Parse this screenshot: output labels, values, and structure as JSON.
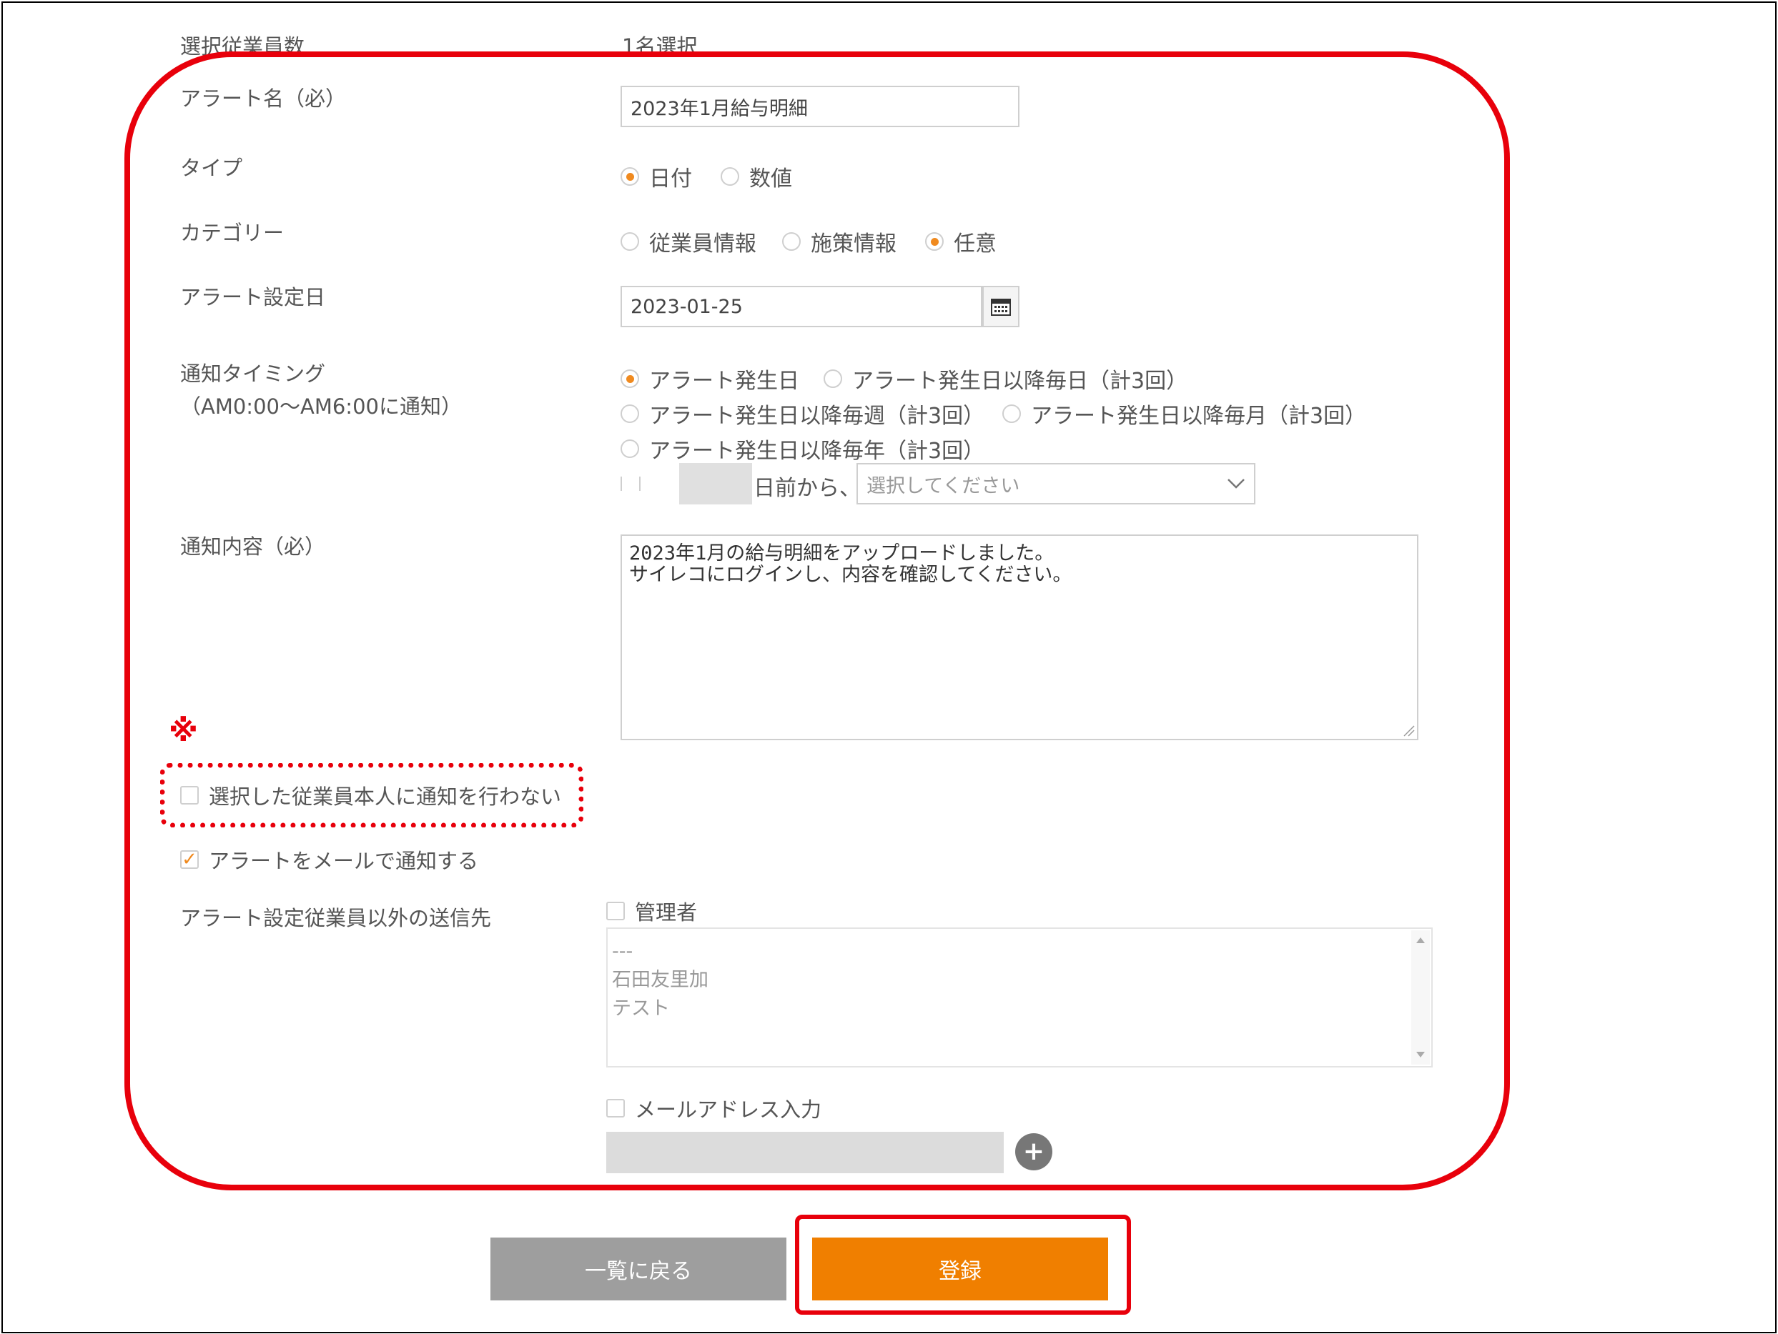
{
  "employees": {
    "label": "選択従業員数",
    "value": "1名選択"
  },
  "alert_name": {
    "label": "アラート名（必）",
    "value": "2023年1月給与明細"
  },
  "type": {
    "label": "タイプ",
    "options": [
      "日付",
      "数値"
    ],
    "selected": "日付"
  },
  "category": {
    "label": "カテゴリー",
    "options": [
      "従業員情報",
      "施策情報",
      "任意"
    ],
    "selected": "任意"
  },
  "alert_date": {
    "label": "アラート設定日",
    "value": "2023-01-25"
  },
  "timing": {
    "label": "通知タイミング",
    "sublabel": "（AM0:00～AM6:00に通知）",
    "options": [
      "アラート発生日",
      "アラート発生日以降毎日（計3回）",
      "アラート発生日以降毎週（計3回）",
      "アラート発生日以降毎月（計3回）",
      "アラート発生日以降毎年（計3回）"
    ],
    "selected": "アラート発生日",
    "days_before_text": "日前から、",
    "select_placeholder": "選択してください"
  },
  "content": {
    "label": "通知内容（必）",
    "value": "2023年1月の給与明細をアップロードしました。\nサイレコにログインし、内容を確認してください。"
  },
  "note_mark": "※",
  "no_notify_self": {
    "label": "選択した従業員本人に通知を行わない",
    "checked": false
  },
  "email_notify": {
    "label": "アラートをメールで通知する",
    "checked": true
  },
  "recipients": {
    "label": "アラート設定従業員以外の送信先",
    "admin_label": "管理者",
    "list": [
      "---",
      "石田友里加",
      "テスト"
    ],
    "email_input_label": "メールアドレス入力"
  },
  "buttons": {
    "back": "一覧に戻る",
    "register": "登録"
  },
  "colors": {
    "accent": "#f08a1f",
    "highlight": "#e8000b",
    "back_button": "#9e9e9e"
  }
}
